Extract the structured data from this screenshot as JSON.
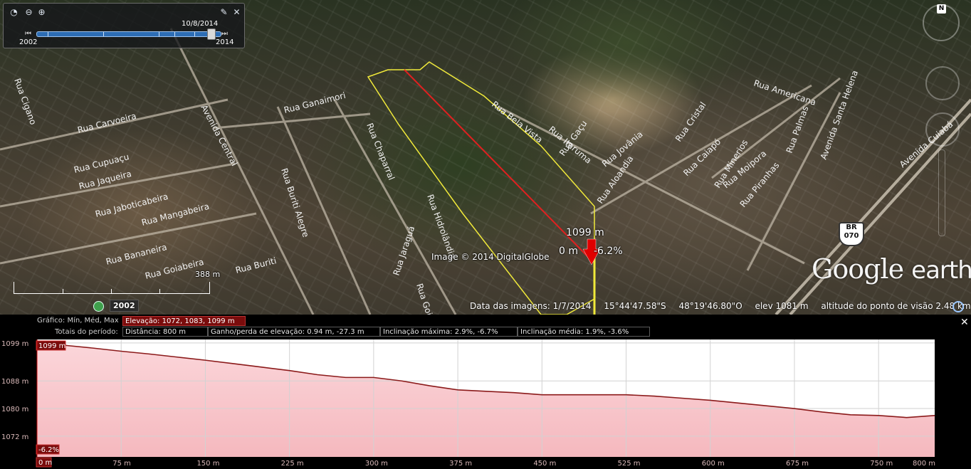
{
  "map": {
    "street_labels": [
      "Rua Carvoeira",
      "Rua Jaqueira",
      "Rua Cupuaçu",
      "Rua Jaboticabeira",
      "Rua Mangabeira",
      "Rua Bananeira",
      "Rua Goiabeira",
      "Rua Buriti",
      "Rua Ganaimori",
      "Avenida Central",
      "Rua Cigano",
      "Rua Chaparral",
      "Rua Bela Vista",
      "Rua Itaruma",
      "Rua Gaçu",
      "Rua Jovânia",
      "Rua Aloandia",
      "Rua Cristal",
      "Rua Caiapó",
      "Rua Moipora",
      "Rua Americana",
      "Rua Minerios",
      "Rua Piranhas",
      "Rua Palmas",
      "Avenida Santa Helena",
      "Avenida Cuiabá",
      "Rua Jaraguá",
      "Rua Goianésia",
      "Rua Hidrolândia",
      "Rua Buriti Alegre"
    ],
    "copyright": "Image © 2014 DigitalGlobe",
    "scale_label": "388 m",
    "path_end_elev": "1099 m",
    "path_start_distance": "0 m",
    "path_slope": "-6.2%",
    "road_shield": "BR\n070",
    "brand": {
      "google": "Google",
      "earth": "earth"
    },
    "compass_letter": "N"
  },
  "timebar": {
    "date": "10/8/2014",
    "year_start": "2002",
    "year_end": "2014"
  },
  "historical": {
    "year": "2002"
  },
  "status": {
    "imagery_date": "Data das imagens: 1/7/2014",
    "lat": "15°44'47.58\"S",
    "lon": "48°19'46.80\"O",
    "elev": "elev  1081 m",
    "eye_alt": "altitude do ponto de visão   2.48 km"
  },
  "profile": {
    "header_graph": "Gráfico:  Mín, Méd, Max",
    "header_elev": "Elevação: 1072, 1083, 1099 m",
    "header_totals": "Totais do período:",
    "distance": "Distância: 800 m",
    "gain_loss": "Ganho/perda de elevação: 0.94 m, -27.3 m",
    "max_slope": "Inclinação máxima: 2.9%, -6.7%",
    "avg_slope": "Inclinação média: 1.9%, -3.6%",
    "cursor_elev": "1099 m",
    "cursor_slope": "-6.2%",
    "cursor_dist": "0 m"
  },
  "chart_data": {
    "type": "area",
    "xlabel": "",
    "ylabel": "",
    "x_ticks": [
      "75 m",
      "150 m",
      "225 m",
      "300 m",
      "375 m",
      "450 m",
      "525 m",
      "600 m",
      "675 m",
      "750 m",
      "800 m"
    ],
    "y_ticks": [
      "1099 m",
      "1088 m",
      "1080 m",
      "1072 m"
    ],
    "y_tick_values": [
      1099,
      1088,
      1080,
      1072
    ],
    "xlim": [
      0,
      800
    ],
    "ylim": [
      1066,
      1100
    ],
    "grid": true,
    "line_color": "#8b1a1a",
    "fill_color": "#f5b8be",
    "x": [
      0,
      25,
      50,
      75,
      100,
      125,
      150,
      175,
      200,
      225,
      250,
      275,
      300,
      325,
      350,
      375,
      400,
      425,
      450,
      475,
      500,
      525,
      550,
      575,
      600,
      625,
      650,
      675,
      700,
      725,
      750,
      775,
      800
    ],
    "y": [
      1099,
      1098.3,
      1097.5,
      1096.6,
      1095.8,
      1094.9,
      1094.0,
      1093.0,
      1092.0,
      1091.0,
      1089.8,
      1089.0,
      1089.0,
      1088.0,
      1086.6,
      1085.4,
      1085.0,
      1084.6,
      1084.0,
      1084.0,
      1084.0,
      1084.0,
      1083.6,
      1083.0,
      1082.4,
      1081.6,
      1080.8,
      1080.0,
      1079.0,
      1078.2,
      1078.0,
      1077.4,
      1078.0
    ]
  }
}
